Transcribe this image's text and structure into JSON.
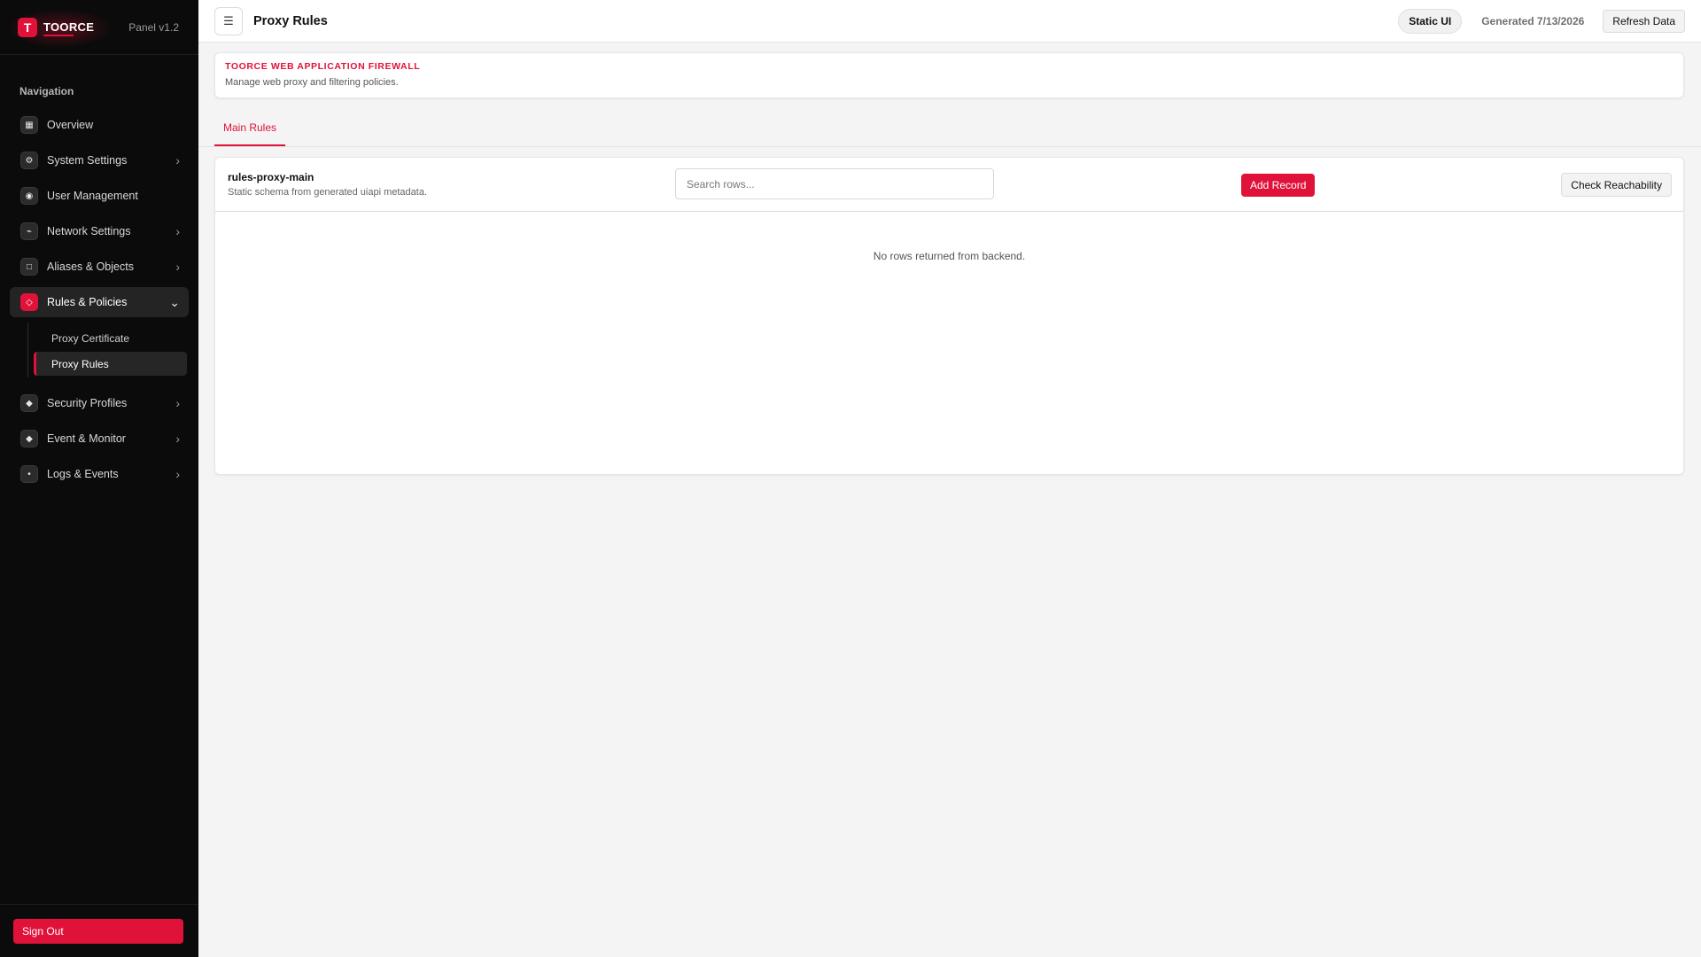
{
  "brand": {
    "logo_letter": "T",
    "name": "TOORCE",
    "version": "Panel v1.2",
    "accent_color": "#e0123a"
  },
  "sidebar": {
    "heading": "Navigation",
    "items": [
      {
        "label": "Overview",
        "icon": "grid-icon",
        "glyph": "▦",
        "expandable": false
      },
      {
        "label": "System Settings",
        "icon": "gear-icon",
        "glyph": "⚙",
        "expandable": true
      },
      {
        "label": "User Management",
        "icon": "user-icon",
        "glyph": "◉",
        "expandable": false
      },
      {
        "label": "Network Settings",
        "icon": "network-icon",
        "glyph": "⌁",
        "expandable": true
      },
      {
        "label": "Aliases & Objects",
        "icon": "box-icon",
        "glyph": "□",
        "expandable": true
      },
      {
        "label": "Rules & Policies",
        "icon": "rules-icon",
        "glyph": "◇",
        "expandable": true,
        "expanded": true,
        "active": true
      },
      {
        "label": "Security Profiles",
        "icon": "shield-icon",
        "glyph": "◆",
        "expandable": true
      },
      {
        "label": "Event & Monitor",
        "icon": "monitor-icon",
        "glyph": "◆",
        "expandable": true
      },
      {
        "label": "Logs & Events",
        "icon": "log-icon",
        "glyph": "•",
        "expandable": true
      }
    ],
    "sub_items": [
      {
        "label": "Proxy Certificate",
        "active": false
      },
      {
        "label": "Proxy Rules",
        "active": true
      }
    ],
    "signout_label": "Sign Out"
  },
  "topbar": {
    "menu_icon": "☰",
    "title": "Proxy Rules",
    "badge": "Static UI",
    "generated": "Generated 7/13/2026",
    "refresh_label": "Refresh Data"
  },
  "banner": {
    "title": "TOORCE WEB APPLICATION FIREWALL",
    "subtitle": "Manage web proxy and filtering policies."
  },
  "tabs": [
    {
      "label": "Main Rules",
      "active": true
    }
  ],
  "table": {
    "name": "rules-proxy-main",
    "description": "Static schema from generated uiapi metadata.",
    "search_placeholder": "Search rows...",
    "search_value": "",
    "add_label": "Add Record",
    "check_label": "Check Reachability",
    "empty_message": "No rows returned from backend."
  }
}
